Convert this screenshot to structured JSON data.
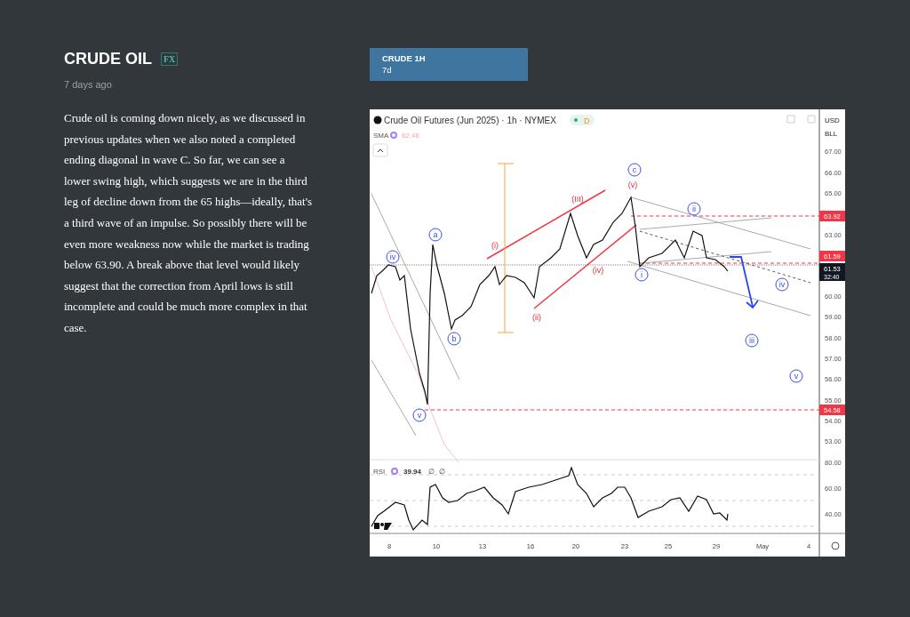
{
  "article": {
    "title": "CRUDE OIL",
    "badge": "FX",
    "time": "7 days ago",
    "body": "Crude oil is coming down nicely, as we discussed in previous updates when we also noted a completed ending diagonal in wave C. So far, we can see a lower swing high, which suggests we are in the third leg of decline down from the 65 highs—ideally, that's a third wave of an impulse. So possibly there will be even more weakness now while the market is trading below 63.90. A break above that level would likely suggest that the correction from April lows is still incomplete and could be much more complex in that case."
  },
  "chart_card": {
    "title": "CRUDE 1H",
    "subtitle": "7d"
  },
  "chart": {
    "symbol": "Crude Oil Futures (Jun 2025) · 1h · NYMEX",
    "status": "D",
    "currency": "USD",
    "unit": "BLL",
    "sma_label": "SMA",
    "sma_value": "62.46",
    "price_ticks": [
      "67.00",
      "66.00",
      "65.00",
      "63.00",
      "60.00",
      "59.00",
      "58.00",
      "57.00",
      "56.00",
      "55.00",
      "54.00",
      "53.00"
    ],
    "price_tags": [
      {
        "label": "63.92",
        "kind": "level"
      },
      {
        "label": "61.59",
        "kind": "level"
      },
      {
        "label": "61.53",
        "sublabel": "32:40",
        "kind": "last"
      },
      {
        "label": "54.58",
        "kind": "level"
      }
    ],
    "wave_labels": [
      {
        "label": "iv",
        "kind": "circle"
      },
      {
        "label": "a",
        "kind": "circle"
      },
      {
        "label": "b",
        "kind": "circle"
      },
      {
        "label": "v",
        "kind": "circle"
      },
      {
        "label": "c",
        "kind": "circle"
      },
      {
        "label": "i",
        "kind": "circle"
      },
      {
        "label": "ii",
        "kind": "circle"
      },
      {
        "label": "iv",
        "kind": "circle"
      },
      {
        "label": "iii",
        "kind": "circle"
      },
      {
        "label": "v",
        "kind": "circle"
      },
      {
        "label": "(i)",
        "kind": "paren"
      },
      {
        "label": "(ii)",
        "kind": "paren"
      },
      {
        "label": "(III)",
        "kind": "paren"
      },
      {
        "label": "(iv)",
        "kind": "paren"
      },
      {
        "label": "(v)",
        "kind": "paren"
      }
    ],
    "rsi": {
      "label": "RSI",
      "value": "39.94",
      "params": [
        "∅",
        "∅"
      ],
      "ticks": [
        "80.00",
        "60.00",
        "40.00"
      ]
    },
    "dates": [
      "8",
      "10",
      "13",
      "16",
      "20",
      "23",
      "25",
      "29",
      "May",
      "4"
    ]
  }
}
